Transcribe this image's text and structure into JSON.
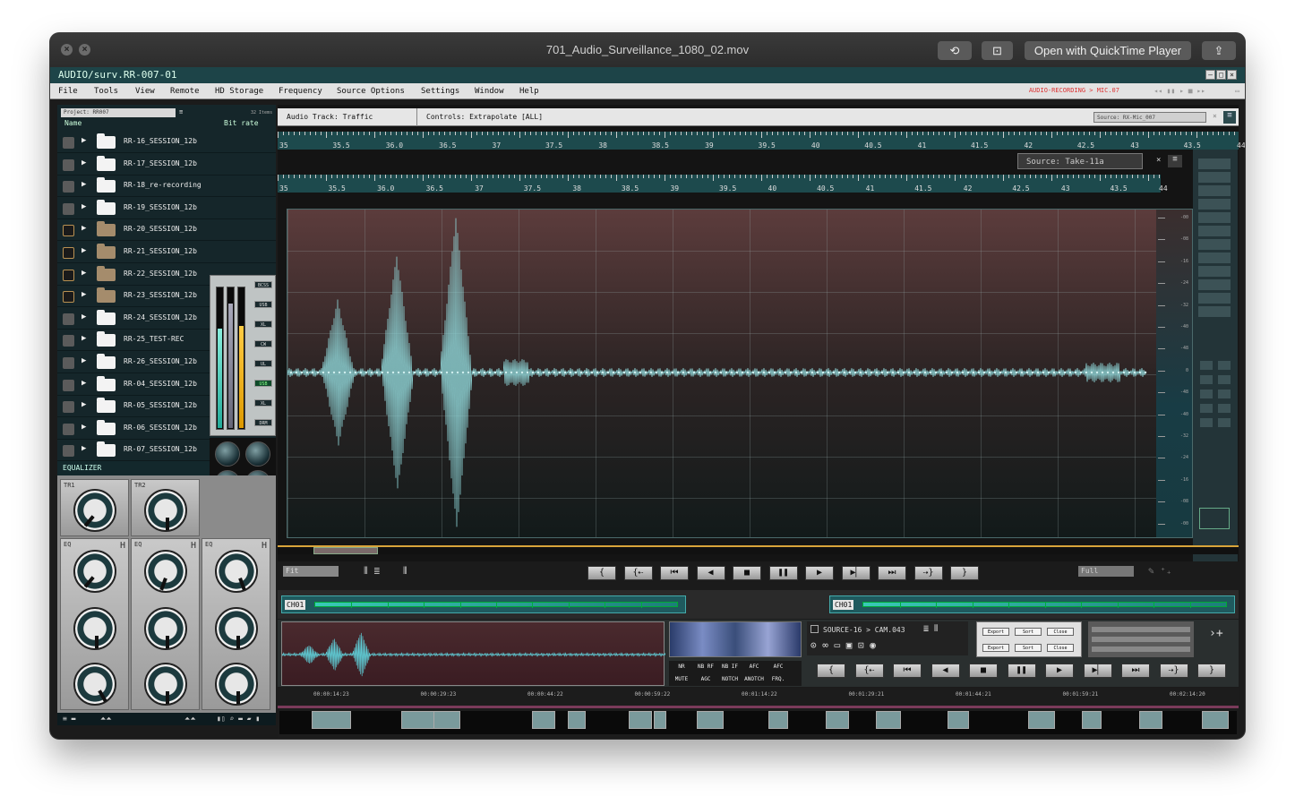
{
  "window": {
    "title": "701_Audio_Surveillance_1080_02.mov",
    "open_label": "Open with QuickTime Player"
  },
  "app": {
    "title": "AUDIO/surv.RR-007-01"
  },
  "menu": [
    "File",
    "Tools",
    "View",
    "Remote",
    "HD Storage",
    "Frequency",
    "Source Options",
    "Settings",
    "Window",
    "Help"
  ],
  "recording": "AUDIO-RECORDING > MIC.07",
  "browser": {
    "project": "Project: RR007",
    "items_label": "32 Items",
    "col_name": "Name",
    "col_bitrate": "Bit rate",
    "files": [
      {
        "name": "RR-16_SESSION_12b",
        "brown": false
      },
      {
        "name": "RR-17_SESSION_12b",
        "brown": false
      },
      {
        "name": "RR-18_re-recording",
        "brown": false
      },
      {
        "name": "RR-19_SESSION_12b",
        "brown": false
      },
      {
        "name": "RR-20_SESSION_12b",
        "brown": true
      },
      {
        "name": "RR-21_SESSION_12b",
        "brown": true
      },
      {
        "name": "RR-22_SESSION_12b",
        "brown": true
      },
      {
        "name": "RR-23_SESSION_12b",
        "brown": true
      },
      {
        "name": "RR-24_SESSION_12b",
        "brown": false
      },
      {
        "name": "RR-25_TEST-REC",
        "brown": false
      },
      {
        "name": "RR-26_SESSION_12b",
        "brown": false
      },
      {
        "name": "RR-04_SESSION_12b",
        "brown": false
      },
      {
        "name": "RR-05_SESSION_12b",
        "brown": false
      },
      {
        "name": "RR-06_SESSION_12b",
        "brown": false
      },
      {
        "name": "RR-07_SESSION_12b",
        "brown": false
      }
    ]
  },
  "meter_tags": [
    "BCSS",
    "USB",
    "XL",
    "CW",
    "UL",
    "USB",
    "XL",
    "DRM"
  ],
  "equalizer": {
    "label": "EQUALIZER",
    "tr1": "TR1",
    "tr2": "TR2",
    "eq": "EQ",
    "h": "H"
  },
  "track": {
    "audio_track": "Audio Track: Traffic",
    "controls": "Controls: Extrapolate [ALL]",
    "source": "Source: RX-Mic_007",
    "source2": "Source: Take-11a"
  },
  "ruler": [
    "35",
    "35.5",
    "36.0",
    "36.5",
    "37",
    "37.5",
    "38",
    "38.5",
    "39",
    "39.5",
    "40",
    "40.5",
    "41",
    "41.5",
    "42",
    "42.5",
    "43",
    "43.5",
    "44"
  ],
  "scale": [
    "-00",
    "-08",
    "-16",
    "-24",
    "-32",
    "-40",
    "-48",
    "0",
    "-48",
    "-40",
    "-32",
    "-24",
    "-16",
    "-08",
    "-00"
  ],
  "transport": {
    "fit": "Fit",
    "full": "Full"
  },
  "channel": {
    "ch1": "CH01",
    "ch2": "CH01"
  },
  "source_path": "SOURCE-16 > CAM.043",
  "nr": [
    "NR",
    "NB RF",
    "NB IF",
    "AFC",
    "AFC",
    "MUTE",
    "AGC",
    "NOTCH",
    "ANOTCH",
    "FRQ."
  ],
  "export": [
    "Export",
    "Sort",
    "Close",
    "Export",
    "Sort",
    "Close"
  ],
  "timeline": [
    "00:00:14:23",
    "00:00:29:23",
    "00:00:44:22",
    "00:00:59:22",
    "00:01:14:22",
    "00:01:29:21",
    "00:01:44:21",
    "00:01:59:21",
    "00:02:14:20"
  ]
}
